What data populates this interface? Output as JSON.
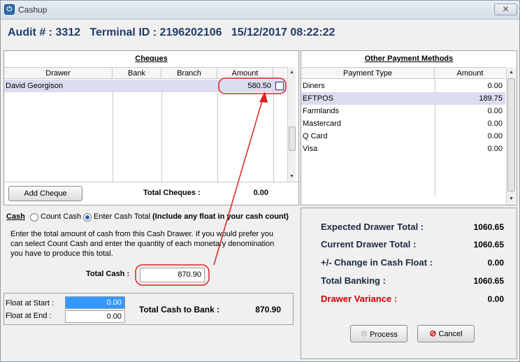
{
  "window": {
    "title": "Cashup",
    "close_glyph": "✕"
  },
  "header": {
    "audit": "Audit # : 3312",
    "terminal": "Terminal ID : 2196202106",
    "datetime": "15/12/2017 08:22:22"
  },
  "cheques": {
    "title": "Cheques",
    "columns": [
      "Drawer",
      "Bank",
      "Branch",
      "Amount"
    ],
    "rows": [
      {
        "drawer": "David Georgison",
        "bank": "",
        "branch": "",
        "amount": "580.50"
      }
    ],
    "add_button": "Add Cheque",
    "total_label": "Total Cheques :",
    "total_value": "0.00"
  },
  "other_payments": {
    "title": "Other Payment Methods",
    "columns": [
      "Payment Type",
      "Amount"
    ],
    "rows": [
      {
        "type": "Diners",
        "amount": "0.00"
      },
      {
        "type": "EFTPOS",
        "amount": "189.75"
      },
      {
        "type": "Farmlands",
        "amount": "0.00"
      },
      {
        "type": "Mastercard",
        "amount": "0.00"
      },
      {
        "type": "Q Card",
        "amount": "0.00"
      },
      {
        "type": "Visa",
        "amount": "0.00"
      }
    ]
  },
  "cash": {
    "label": "Cash",
    "option_count": "Count Cash",
    "option_enter": "Enter Cash Total",
    "selected": "Enter Cash Total",
    "note": "(Include any float in your cash count)",
    "instructions": [
      "Enter the total amount of cash from this Cash Drawer.  If you would prefer you",
      "can select Count Cash and enter the quantity of each monetary denomination",
      "you have to produce this total."
    ],
    "total_label": "Total Cash :",
    "total_value": "870.90"
  },
  "float": {
    "start_label": "Float at Start :",
    "start_value": "0.00",
    "end_label": "Float at End :",
    "end_value": "0.00",
    "bank_label": "Total Cash to Bank :",
    "bank_value": "870.90"
  },
  "summary": {
    "expected_label": "Expected Drawer Total :",
    "expected_value": "1060.65",
    "current_label": "Current Drawer Total :",
    "current_value": "1060.65",
    "change_label": "+/- Change in Cash Float :",
    "change_value": "0.00",
    "banking_label": "Total Banking :",
    "banking_value": "1060.65",
    "variance_label": "Drawer Variance :",
    "variance_value": "0.00",
    "variance_color": "#cc0000"
  },
  "actions": {
    "process": "Process",
    "cancel": "Cancel"
  },
  "annotation": {
    "color": "#e02020"
  }
}
